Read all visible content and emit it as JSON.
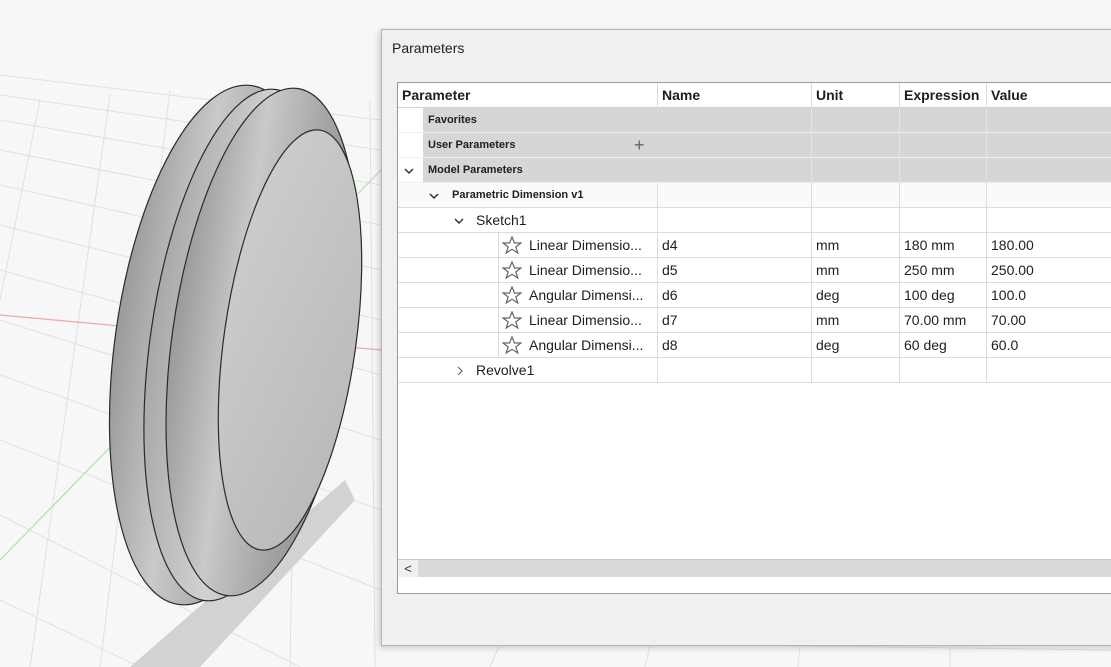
{
  "dialog": {
    "title": "Parameters"
  },
  "table": {
    "columns": [
      "Parameter",
      "Name",
      "Unit",
      "Expression",
      "Value"
    ],
    "groups": {
      "favorites": "Favorites",
      "user_parameters": "User Parameters",
      "user_add_icon": "+",
      "model_parameters": "Model Parameters"
    },
    "component": "Parametric Dimension v1",
    "sketch": "Sketch1",
    "rows": [
      {
        "parameter": "Linear Dimensio...",
        "name": "d4",
        "unit": "mm",
        "expression": "180 mm",
        "value": "180.00"
      },
      {
        "parameter": "Linear Dimensio...",
        "name": "d5",
        "unit": "mm",
        "expression": "250 mm",
        "value": "250.00"
      },
      {
        "parameter": "Angular Dimensi...",
        "name": "d6",
        "unit": "deg",
        "expression": "100 deg",
        "value": "100.0"
      },
      {
        "parameter": "Linear Dimensio...",
        "name": "d7",
        "unit": "mm",
        "expression": "70.00 mm",
        "value": "70.00"
      },
      {
        "parameter": "Angular Dimensi...",
        "name": "d8",
        "unit": "deg",
        "expression": "60 deg",
        "value": "60.0"
      }
    ],
    "feature": "Revolve1"
  },
  "icons": {
    "expanded": "chevron-down-icon",
    "collapsed": "chevron-right-icon",
    "favorite": "star-outline-icon",
    "scroll_left": "arrow-left-icon"
  },
  "scroll_left_glyph": "<"
}
